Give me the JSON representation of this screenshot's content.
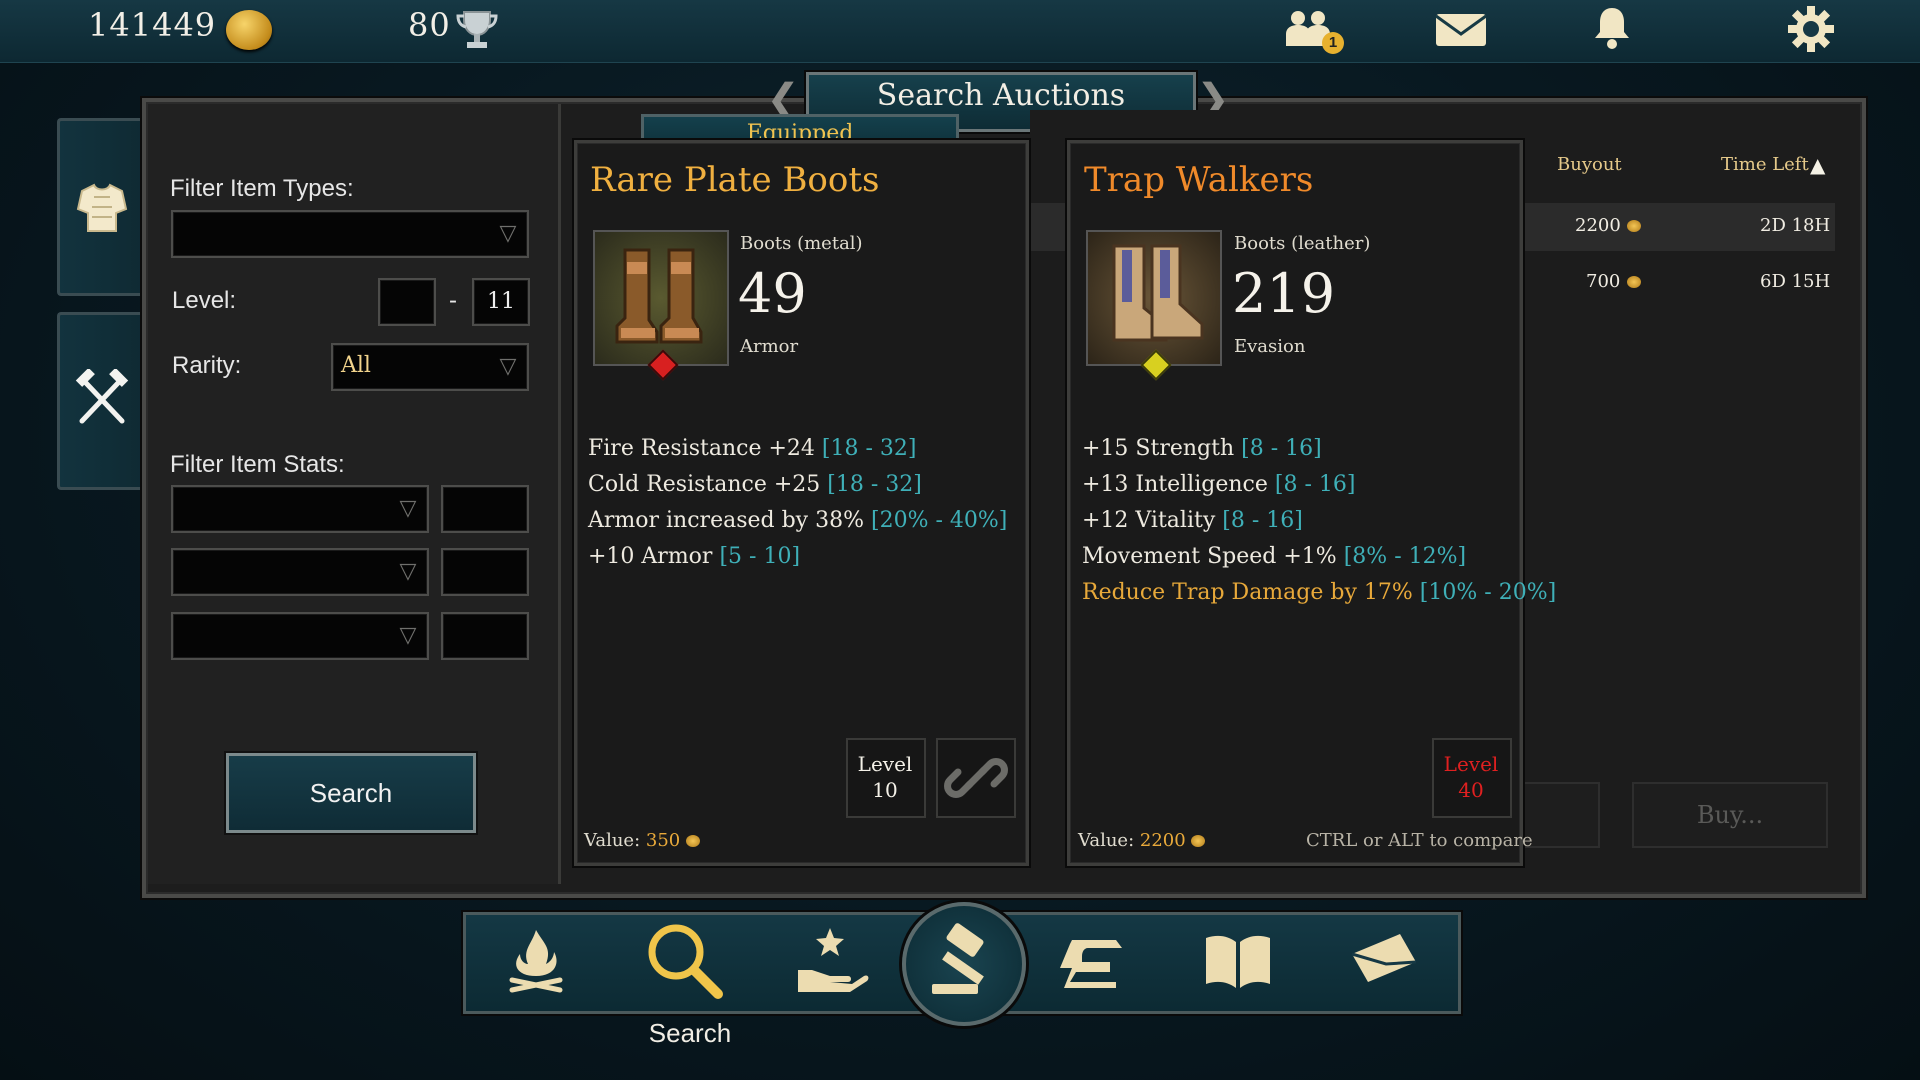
{
  "topbar": {
    "gold": "141449",
    "trophies": "80",
    "friends_badge": "1",
    "icons": [
      "coin-icon",
      "trophy-icon",
      "friends-icon",
      "mail-icon",
      "bell-icon",
      "gear-icon"
    ]
  },
  "window": {
    "title": "Search Auctions"
  },
  "filter": {
    "item_types_label": "Filter Item Types:",
    "item_types_value": "",
    "level_label": "Level:",
    "level_min": "",
    "level_sep": "-",
    "level_max": "11",
    "rarity_label": "Rarity:",
    "rarity_value": "All",
    "stats_label": "Filter Item Stats:",
    "search_button": "Search"
  },
  "equipped_tab": "Equipped",
  "item_left": {
    "name": "Rare Plate Boots",
    "type": "Boots (metal)",
    "value_number": "49",
    "value_label": "Armor",
    "stats": [
      {
        "text": "Fire Resistance +24",
        "range": "[18 - 32]"
      },
      {
        "text": "Cold Resistance +25",
        "range": "[18 - 32]"
      },
      {
        "text": "Armor increased by 38%",
        "range": "[20% - 40%]"
      },
      {
        "text": "+10 Armor",
        "range": "[5 - 10]"
      }
    ],
    "level_label": "Level",
    "level": "10",
    "value_text_label": "Value:",
    "value_amount": "350"
  },
  "item_right": {
    "name": "Trap Walkers",
    "type": "Boots (leather)",
    "value_number": "219",
    "value_label": "Evasion",
    "stats": [
      {
        "text": "+15 Strength",
        "range": "[8 - 16]"
      },
      {
        "text": "+13 Intelligence",
        "range": "[8 - 16]"
      },
      {
        "text": "+12 Vitality",
        "range": "[8 - 16]"
      },
      {
        "text": "Movement Speed +1%",
        "range": "[8% - 12%]"
      },
      {
        "text": "Reduce Trap Damage by 17%",
        "range": "[10% - 20%]"
      }
    ],
    "level_label": "Level",
    "level": "40",
    "value_text_label": "Value:",
    "value_amount": "2200",
    "compare_hint": "CTRL or ALT to compare"
  },
  "results": {
    "headers": {
      "buyout": "Buyout",
      "time_left": "Time Left"
    },
    "rows": [
      {
        "buyout": "2200",
        "time_left": "2D 18H"
      },
      {
        "buyout": "700",
        "time_left": "6D 15H"
      }
    ],
    "buy_button": "Buy..."
  },
  "bottomnav": {
    "items": [
      "campfire-icon",
      "search-icon",
      "magic-hand-icon",
      "auction-gavel-icon",
      "anvil-icon",
      "book-icon",
      "envelope-icon"
    ],
    "active_label": "Search"
  },
  "colors": {
    "accent_gold": "#f0b040",
    "range_teal": "#3fb0b8",
    "legendary_orange": "#f08a2a",
    "level_red": "#e02020"
  }
}
